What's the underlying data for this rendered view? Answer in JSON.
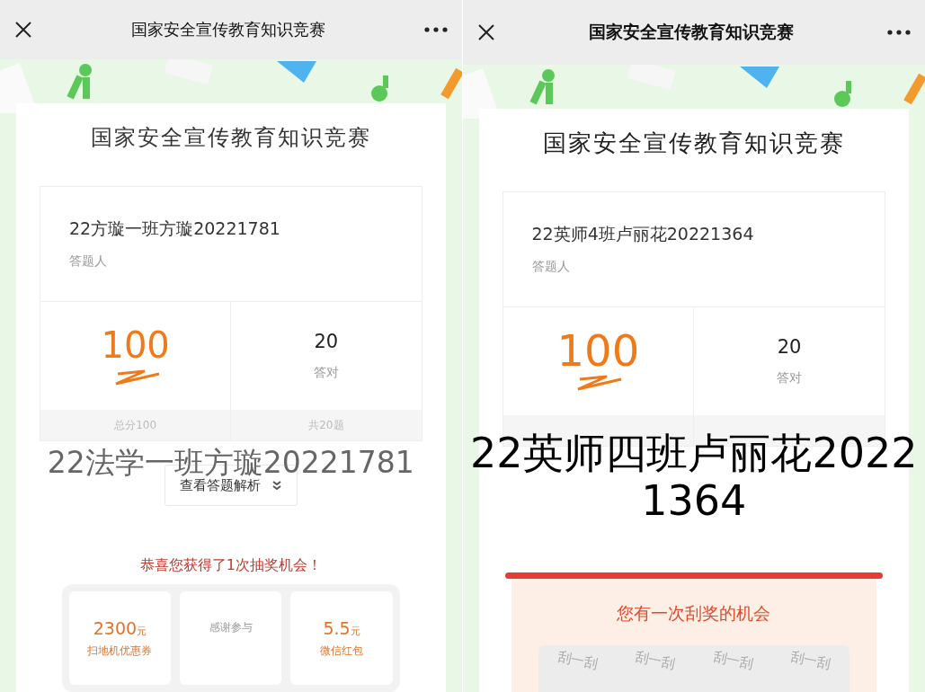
{
  "panels": [
    {
      "kind": "lottery_grid",
      "header": {
        "title": "国家安全宣传教育知识竞赛"
      },
      "card_title": "国家安全宣传教育知识竞赛",
      "respondent": {
        "name": "22方璇一班方璇20221781",
        "label": "答题人"
      },
      "score": {
        "value": "100",
        "footer": "总分100"
      },
      "correct": {
        "value": "20",
        "label": "答对",
        "footer": "共20题"
      },
      "analysis_button": "查看答题解析",
      "caption": "22法学一班方璇20221781",
      "lottery": {
        "heading": "恭喜您获得了1次抽奖机会！",
        "prizes": [
          {
            "amount": "2300",
            "unit": "元",
            "label": "扫地机优惠券"
          },
          {
            "label": "感谢参与"
          },
          {
            "amount": "5.5",
            "unit": "元",
            "label": "微信红包"
          }
        ]
      }
    },
    {
      "kind": "scratch_card",
      "header": {
        "title": "国家安全宣传教育知识竞赛"
      },
      "card_title": "国家安全宣传教育知识竞赛",
      "respondent": {
        "name": "22英师4班卢丽花20221364",
        "label": "答题人"
      },
      "score": {
        "value": "100"
      },
      "correct": {
        "value": "20",
        "label": "答对"
      },
      "caption": "22英师四班卢丽花20221364",
      "scratch": {
        "heading": "您有一次刮奖的机会",
        "marks": [
          "刮一刮",
          "刮一刮",
          "刮一刮",
          "刮一刮"
        ]
      }
    }
  ]
}
